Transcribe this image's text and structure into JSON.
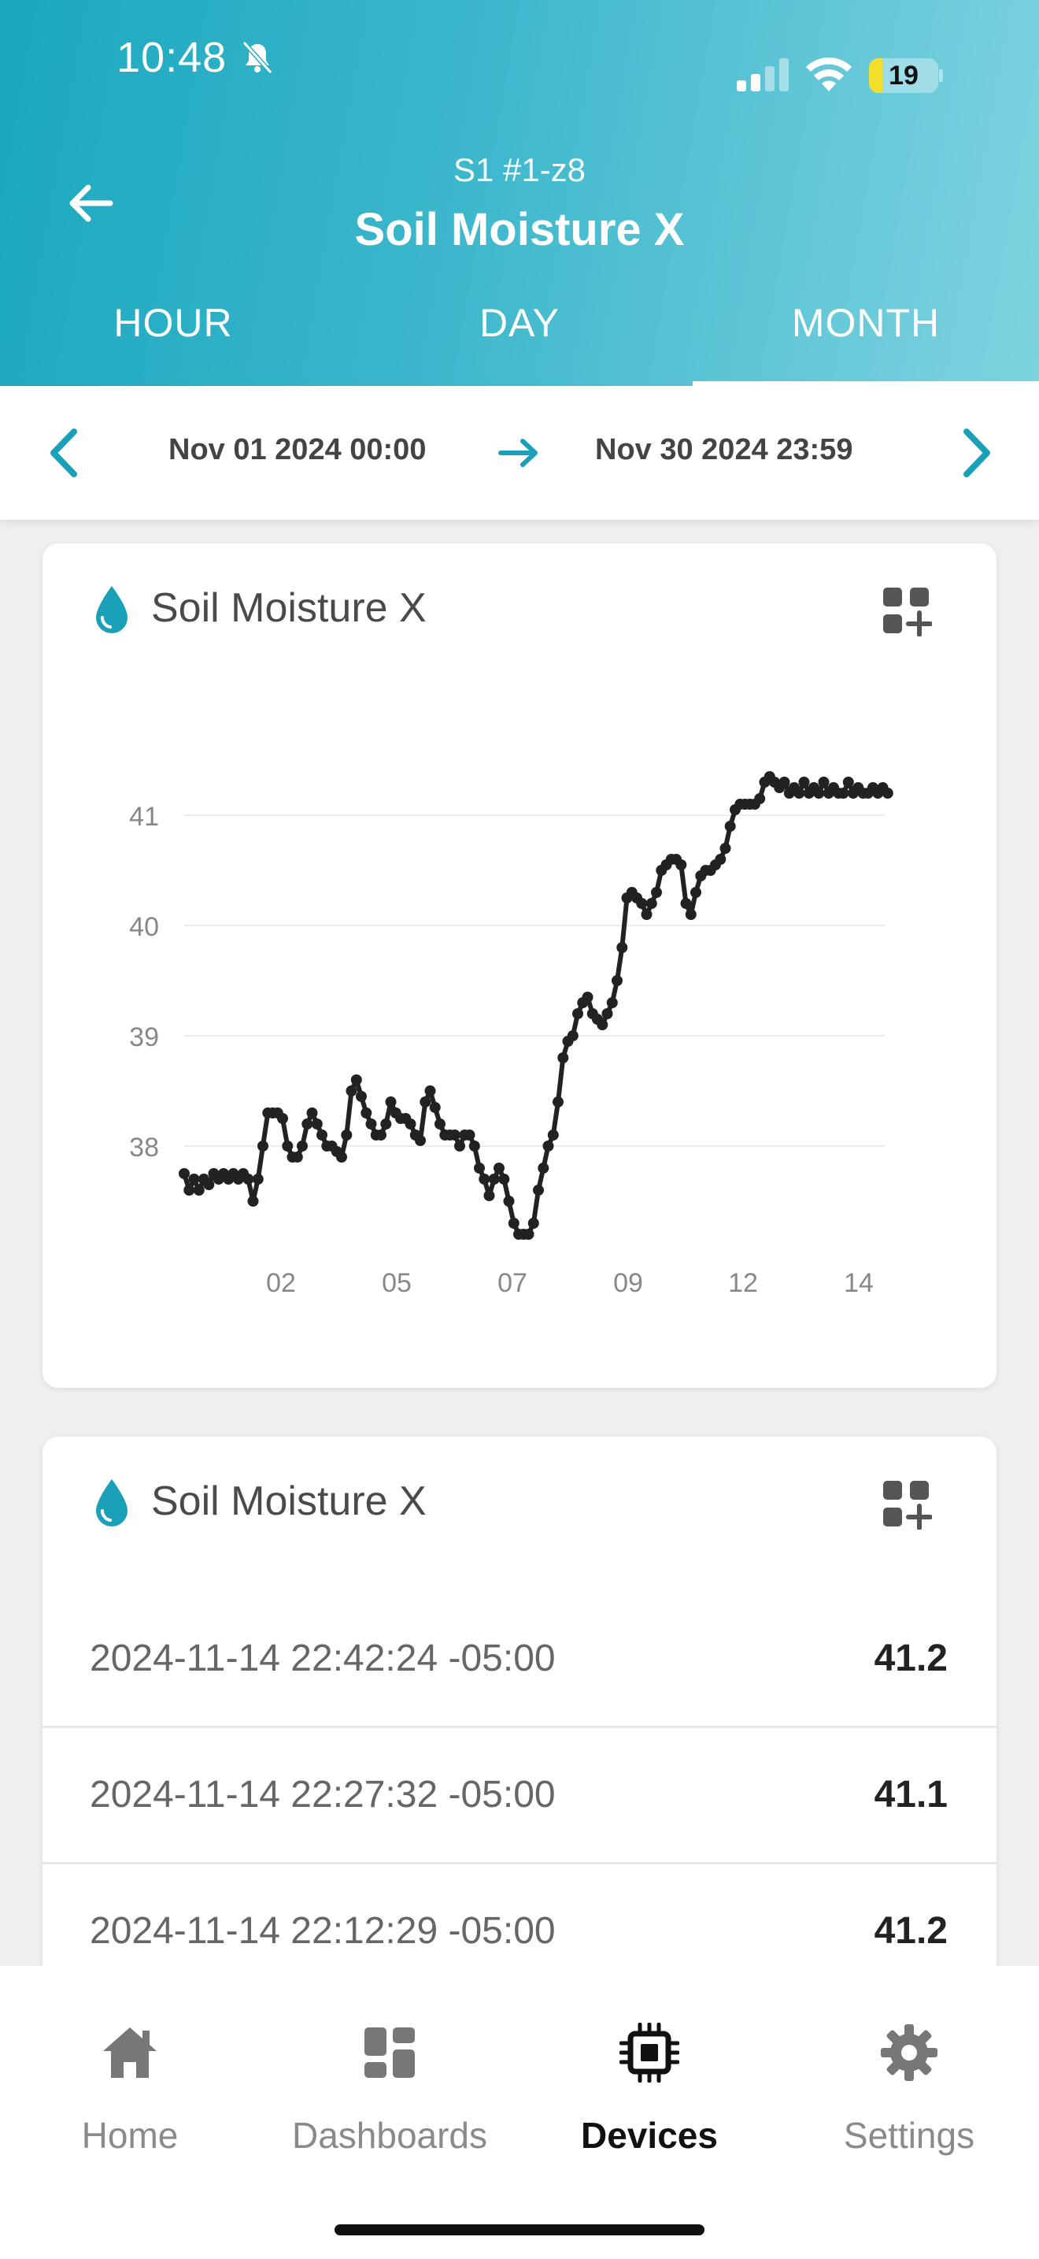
{
  "status_bar": {
    "time": "10:48",
    "battery": "19",
    "battery_level": 0.19
  },
  "header": {
    "subtitle": "S1 #1-z8",
    "title": "Soil Moisture X"
  },
  "tabs": [
    {
      "label": "HOUR",
      "active": false
    },
    {
      "label": "DAY",
      "active": false
    },
    {
      "label": "MONTH",
      "active": true
    }
  ],
  "date_range": {
    "start": "Nov 01 2024 00:00",
    "end": "Nov 30 2024 23:59"
  },
  "chart_card": {
    "title": "Soil Moisture X"
  },
  "chart_data": {
    "type": "line",
    "title": "",
    "xlabel": "",
    "ylabel": "",
    "x_ticks": [
      "02",
      "05",
      "07",
      "09",
      "12",
      "14"
    ],
    "y_ticks": [
      38,
      39,
      40,
      41
    ],
    "ylim": [
      37.0,
      41.7
    ],
    "xlim": [
      0,
      14.4
    ],
    "grid": true,
    "series": [
      {
        "color": "#222222",
        "x": [
          0.0,
          0.1,
          0.2,
          0.3,
          0.4,
          0.5,
          0.6,
          0.7,
          0.8,
          0.9,
          1.0,
          1.1,
          1.2,
          1.3,
          1.4,
          1.5,
          1.6,
          1.7,
          1.8,
          1.9,
          2.0,
          2.1,
          2.2,
          2.3,
          2.4,
          2.5,
          2.6,
          2.7,
          2.8,
          2.9,
          3.0,
          3.1,
          3.2,
          3.3,
          3.4,
          3.5,
          3.6,
          3.7,
          3.8,
          3.9,
          4.0,
          4.1,
          4.2,
          4.3,
          4.4,
          4.5,
          4.6,
          4.7,
          4.8,
          4.9,
          5.0,
          5.1,
          5.2,
          5.3,
          5.4,
          5.5,
          5.6,
          5.7,
          5.8,
          5.9,
          6.0,
          6.1,
          6.2,
          6.3,
          6.4,
          6.5,
          6.6,
          6.7,
          6.8,
          6.9,
          7.0,
          7.1,
          7.2,
          7.3,
          7.4,
          7.5,
          7.6,
          7.7,
          7.8,
          7.9,
          8.0,
          8.1,
          8.2,
          8.3,
          8.4,
          8.5,
          8.6,
          8.7,
          8.8,
          8.9,
          9.0,
          9.1,
          9.2,
          9.3,
          9.4,
          9.5,
          9.6,
          9.7,
          9.8,
          9.9,
          10.0,
          10.1,
          10.2,
          10.3,
          10.4,
          10.5,
          10.6,
          10.7,
          10.8,
          10.9,
          11.0,
          11.1,
          11.2,
          11.3,
          11.4,
          11.5,
          11.6,
          11.7,
          11.8,
          11.9,
          12.0,
          12.1,
          12.2,
          12.3,
          12.4,
          12.5,
          12.6,
          12.7,
          12.8,
          12.9,
          13.0,
          13.1,
          13.2,
          13.3,
          13.4,
          13.5,
          13.6,
          13.7,
          13.8,
          13.9,
          14.0,
          14.1,
          14.2,
          14.3
        ],
        "y": [
          37.75,
          37.6,
          37.7,
          37.6,
          37.7,
          37.65,
          37.75,
          37.7,
          37.75,
          37.7,
          37.75,
          37.7,
          37.75,
          37.7,
          37.5,
          37.7,
          38.0,
          38.3,
          38.3,
          38.3,
          38.25,
          38.0,
          37.9,
          37.9,
          38.0,
          38.2,
          38.3,
          38.2,
          38.1,
          38.0,
          38.0,
          37.95,
          37.9,
          38.1,
          38.5,
          38.6,
          38.45,
          38.3,
          38.2,
          38.1,
          38.1,
          38.2,
          38.4,
          38.3,
          38.25,
          38.25,
          38.2,
          38.1,
          38.05,
          38.4,
          38.5,
          38.35,
          38.2,
          38.1,
          38.1,
          38.1,
          38.0,
          38.1,
          38.1,
          38.0,
          37.8,
          37.7,
          37.55,
          37.7,
          37.8,
          37.7,
          37.5,
          37.3,
          37.2,
          37.2,
          37.2,
          37.3,
          37.6,
          37.8,
          38.0,
          38.1,
          38.4,
          38.8,
          38.95,
          39.0,
          39.2,
          39.3,
          39.35,
          39.2,
          39.15,
          39.1,
          39.2,
          39.3,
          39.5,
          39.8,
          40.25,
          40.3,
          40.25,
          40.2,
          40.1,
          40.2,
          40.3,
          40.5,
          40.55,
          40.6,
          40.6,
          40.55,
          40.2,
          40.1,
          40.3,
          40.45,
          40.5,
          40.5,
          40.55,
          40.6,
          40.7,
          40.9,
          41.05,
          41.1,
          41.1,
          41.1,
          41.1,
          41.15,
          41.3,
          41.35,
          41.3,
          41.25,
          41.3,
          41.2,
          41.25,
          41.2,
          41.3,
          41.2,
          41.25,
          41.2,
          41.3,
          41.2,
          41.25,
          41.2,
          41.2,
          41.3,
          41.2,
          41.25,
          41.2,
          41.2,
          41.25,
          41.2,
          41.25,
          41.2
        ]
      }
    ]
  },
  "list_card": {
    "title": "Soil Moisture X",
    "rows": [
      {
        "time": "2024-11-14 22:42:24 -05:00",
        "value": "41.2"
      },
      {
        "time": "2024-11-14 22:27:32 -05:00",
        "value": "41.1"
      },
      {
        "time": "2024-11-14 22:12:29 -05:00",
        "value": "41.2"
      }
    ]
  },
  "nav": [
    {
      "label": "Home",
      "icon": "home-icon",
      "active": false
    },
    {
      "label": "Dashboards",
      "icon": "dashboards-icon",
      "active": false
    },
    {
      "label": "Devices",
      "icon": "chip-icon",
      "active": true
    },
    {
      "label": "Settings",
      "icon": "gear-icon",
      "active": false
    }
  ],
  "colors": {
    "accent": "#1aa0b8",
    "header_start": "#1aa8bf",
    "header_end": "#7fd3e0"
  }
}
